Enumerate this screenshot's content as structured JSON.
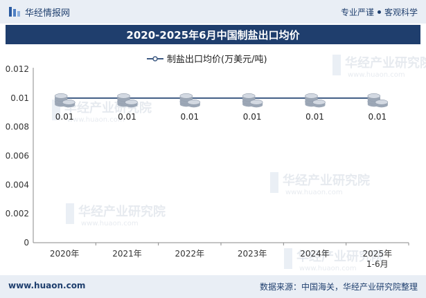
{
  "header": {
    "brand": "华经情报网",
    "tagline_left": "专业严谨",
    "tagline_right": "客观科学"
  },
  "footer": {
    "url": "www.huaon.com",
    "source": "数据来源：中国海关，华经产业研究院整理"
  },
  "watermark": {
    "text": "华经产业研究院",
    "url": "www.huaon.com"
  },
  "colors": {
    "line": "#3d5a82",
    "header_bg": "#1f3e6d",
    "band_bg": "#e9eef5"
  },
  "chart_data": {
    "type": "line",
    "title": "2020-2025年6月中国制盐出口均价",
    "categories": [
      "2020年",
      "2021年",
      "2022年",
      "2023年",
      "2024年",
      "2025年\n1-6月"
    ],
    "series": [
      {
        "name": "制盐出口均价(万美元/吨)",
        "values": [
          0.01,
          0.01,
          0.01,
          0.01,
          0.01,
          0.01
        ],
        "labels": [
          "0.01",
          "0.01",
          "0.01",
          "0.01",
          "0.01",
          "0.01"
        ]
      }
    ],
    "yticks": [
      "0",
      "0.002",
      "0.004",
      "0.006",
      "0.008",
      "0.01",
      "0.012"
    ],
    "ylim": [
      0,
      0.012
    ],
    "legend_position": "top-center",
    "grid": false,
    "marker": "coin-stack-icon"
  }
}
